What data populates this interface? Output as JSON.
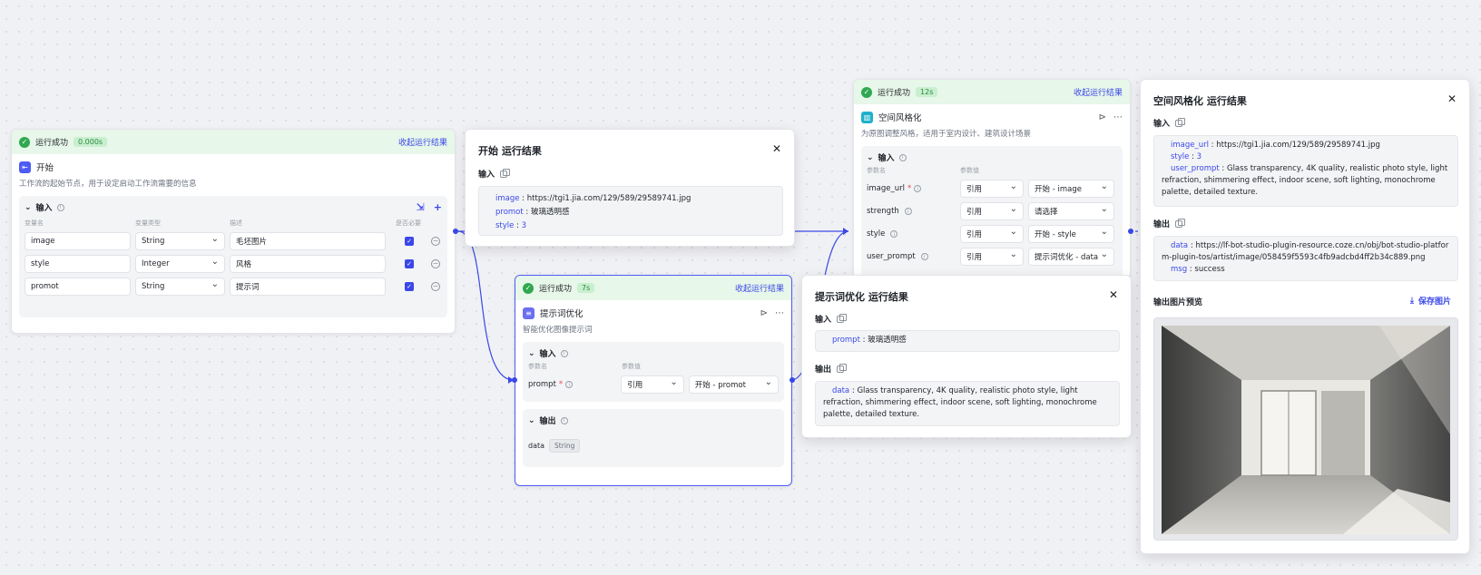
{
  "colors": {
    "accent": "#3a48e8",
    "success": "#2fa84f",
    "status_bg": "#e7f7e9"
  },
  "start_node": {
    "status": "运行成功",
    "time": "0.000s",
    "collapse": "收起运行结果",
    "icon": "start-node-icon",
    "title": "开始",
    "desc": "工作流的起始节点，用于设定启动工作流需要的信息",
    "section": "输入",
    "col_name": "变量名",
    "col_type": "变量类型",
    "col_desc": "描述",
    "col_req": "是否必要",
    "rows": [
      {
        "name": "image",
        "type": "String",
        "desc": "毛坯图片"
      },
      {
        "name": "style",
        "type": "Integer",
        "desc": "风格"
      },
      {
        "name": "promot",
        "type": "String",
        "desc": "提示词"
      }
    ]
  },
  "start_result": {
    "title": "开始 运行结果",
    "input_label": "输入",
    "items": [
      {
        "key": "image",
        "value": "https://tgi1.jia.com/129/589/29589741.jpg"
      },
      {
        "key": "promot",
        "value": "玻璃透明感"
      },
      {
        "key": "style",
        "value": "3"
      }
    ]
  },
  "prompt_node": {
    "status": "运行成功",
    "time": "7s",
    "collapse": "收起运行结果",
    "title": "提示词优化",
    "desc": "智能优化图像提示词",
    "input_section": "输入",
    "col_name": "参数名",
    "col_value": "参数值",
    "param": "prompt",
    "source": "引用",
    "ref": "开始 - promot",
    "output_section": "输出",
    "out_name": "data",
    "out_type": "String"
  },
  "prompt_result": {
    "title": "提示词优化 运行结果",
    "input_label": "输入",
    "input_key": "prompt",
    "input_value": "玻璃透明感",
    "output_label": "输出",
    "output_key": "data",
    "output_value": "Glass transparency, 4K quality, realistic photo style, light refraction, shimmering effect, indoor scene, soft lighting, monochrome palette, detailed texture."
  },
  "style_node": {
    "status": "运行成功",
    "time": "12s",
    "collapse": "收起运行结果",
    "title": "空间风格化",
    "desc": "为原图调整风格，适用于室内设计、建筑设计场景",
    "section": "输入",
    "col_name": "参数名",
    "col_value": "参数值",
    "rows": [
      {
        "name": "image_url",
        "required": "*",
        "source": "引用",
        "ref": "开始 - image"
      },
      {
        "name": "strength",
        "required": "",
        "source": "引用",
        "ref": "请选择"
      },
      {
        "name": "style",
        "required": "",
        "source": "引用",
        "ref": "开始 - style"
      },
      {
        "name": "user_prompt",
        "required": "",
        "source": "引用",
        "ref": "提示词优化 - data"
      }
    ]
  },
  "style_result": {
    "title": "空间风格化 运行结果",
    "input_label": "输入",
    "in_image_key": "image_url",
    "in_image_value": "https://tgi1.jia.com/129/589/29589741.jpg",
    "in_style_key": "style",
    "in_style_value": "3",
    "in_prompt_key": "user_prompt",
    "in_prompt_value": "Glass transparency, 4K quality, realistic photo style, light refraction, shimmering effect, indoor scene, soft lighting, monochrome palette, detailed texture.",
    "output_label": "输出",
    "out_data_key": "data",
    "out_data_value": "https://lf-bot-studio-plugin-resource.coze.cn/obj/bot-studio-platform-plugin-tos/artist/image/058459f5593c4fb9adcbd4ff2b34c889.png",
    "out_msg_key": "msg",
    "out_msg_value": "success",
    "preview_label": "输出图片预览",
    "save_label": "保存图片"
  }
}
